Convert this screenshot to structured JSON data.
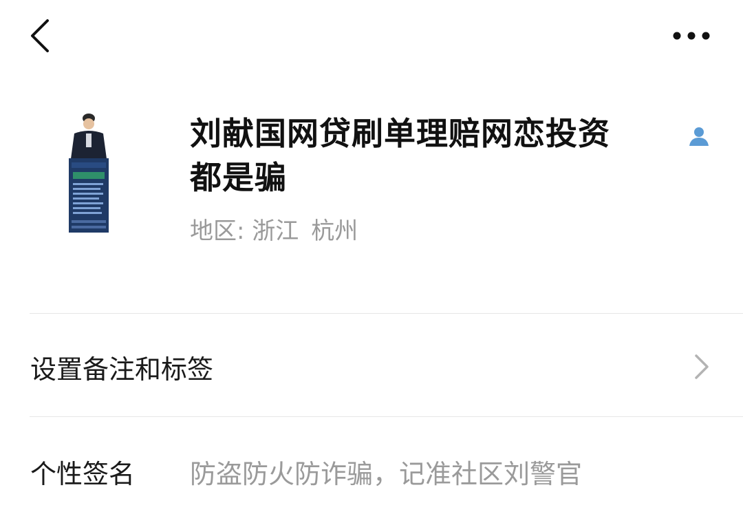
{
  "profile": {
    "name_line1": "刘献国网贷刷单理赔网恋投资",
    "name_line2": "都是骗",
    "region_label": "地区: ",
    "region_province": "浙江",
    "region_city": "杭州"
  },
  "rows": {
    "remark": {
      "label": "设置备注和标签"
    },
    "signature": {
      "label": "个性签名",
      "value": "防盗防火防诈骗，记准社区刘警官"
    }
  },
  "icons": {
    "back": "chevron-left-icon",
    "more": "more-dots-icon",
    "person": "person-icon",
    "chevron": "chevron-right-icon"
  },
  "colors": {
    "person_icon": "#5b9bd5",
    "secondary_text": "#9a9a9a",
    "primary_text": "#111111",
    "divider": "#e6e6e6",
    "avatar_board": "#1f3a66"
  }
}
